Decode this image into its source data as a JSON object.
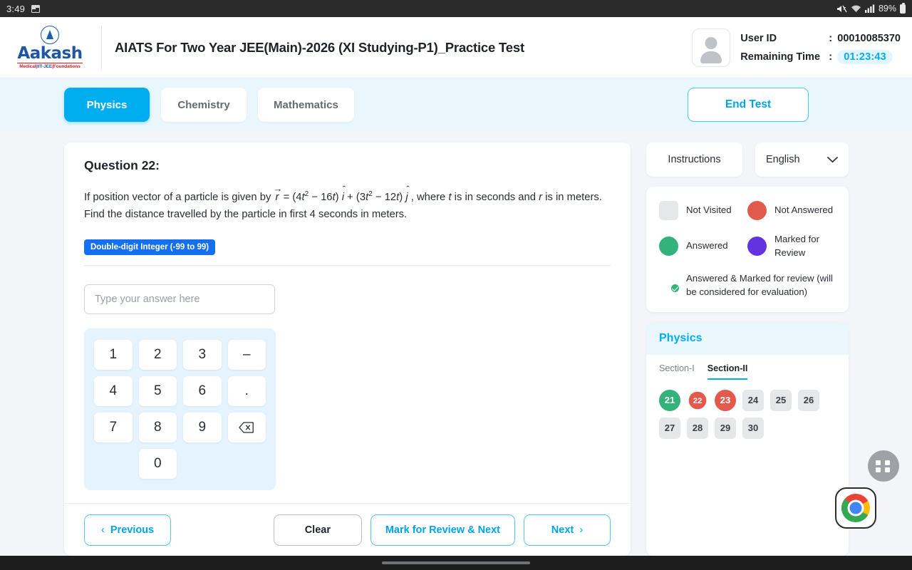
{
  "status_bar": {
    "clock": "3:49",
    "battery_pct": "89%",
    "icons": [
      "screenshot-icon",
      "mute-icon",
      "wifi-icon",
      "signal-icon",
      "battery-icon"
    ]
  },
  "header": {
    "logo_word": "Aakash",
    "logo_sub_1": "Medical",
    "logo_sub_2": "IIT-JEE",
    "logo_sub_3": "Foundations",
    "test_title": "AIATS For Two Year JEE(Main)-2026 (XI Studying-P1)_Practice Test",
    "user_id_label": "User ID",
    "user_id_value": "00010085370",
    "remaining_time_label": "Remaining Time",
    "remaining_time_value": "01:23:43",
    "colon": ":",
    "timer_color": "#00aeef"
  },
  "tabs": {
    "items": [
      {
        "label": "Physics",
        "active": true
      },
      {
        "label": "Chemistry",
        "active": false
      },
      {
        "label": "Mathematics",
        "active": false
      }
    ],
    "end_test_label": "End Test",
    "active_color": "#00aeef"
  },
  "question": {
    "title": "Question 22:",
    "text_part1": "If position vector of a particle is given by",
    "vec_r": "r",
    "eq_open": "= (4",
    "t1": "t",
    "sup1": "2",
    "mid1": "− 16",
    "t2": "t",
    "close1": ")",
    "ihat": "i",
    "plus": "+ (3",
    "t3": "t",
    "sup2": "2",
    "mid2": "− 12",
    "t4": "t",
    "close2": ")",
    "jhat": "j",
    "text_part2": ", where",
    "t5": "t",
    "text_part3": "is in seconds and",
    "r_italic": "r",
    "text_part4": "is in meters. Find the distance travelled by the particle in first 4 seconds in meters.",
    "type_badge": "Double-digit Integer (-99 to 99)",
    "badge_color": "#1470ef"
  },
  "answer": {
    "placeholder": "Type your answer here",
    "value": "",
    "keypad": [
      "1",
      "2",
      "3",
      "–",
      "4",
      "5",
      "6",
      ".",
      "7",
      "8",
      "9",
      "backspace",
      "blank",
      "0",
      "blank",
      "blank"
    ]
  },
  "footer": {
    "previous_label": "Previous",
    "clear_label": "Clear",
    "mark_review_label": "Mark for Review & Next",
    "next_label": "Next"
  },
  "rail": {
    "instructions_label": "Instructions",
    "language_value": "English"
  },
  "legend": [
    {
      "label": "Not Visited",
      "color": "#e6e7e9",
      "shape": "square"
    },
    {
      "label": "Not Answered",
      "color": "#e2594d",
      "shape": "circle"
    },
    {
      "label": "Answered",
      "color": "#34b27b",
      "shape": "circle"
    },
    {
      "label": "Marked for Review",
      "color": "#6433e0",
      "shape": "circle"
    },
    {
      "label": "Answered & Marked for review (will be considered for evaluation)",
      "color": "#6433e0",
      "shape": "circle-badge"
    }
  ],
  "palette": {
    "subject": "Physics",
    "sections": [
      {
        "label": "Section-I",
        "active": false
      },
      {
        "label": "Section-II",
        "active": true
      }
    ],
    "questions": [
      {
        "num": "21",
        "state": "answered"
      },
      {
        "num": "22",
        "state": "current"
      },
      {
        "num": "23",
        "state": "notanswered"
      },
      {
        "num": "24",
        "state": "notvisited"
      },
      {
        "num": "25",
        "state": "notvisited"
      },
      {
        "num": "26",
        "state": "notvisited"
      },
      {
        "num": "27",
        "state": "notvisited"
      },
      {
        "num": "28",
        "state": "notvisited"
      },
      {
        "num": "29",
        "state": "notvisited"
      },
      {
        "num": "30",
        "state": "notvisited"
      }
    ]
  }
}
